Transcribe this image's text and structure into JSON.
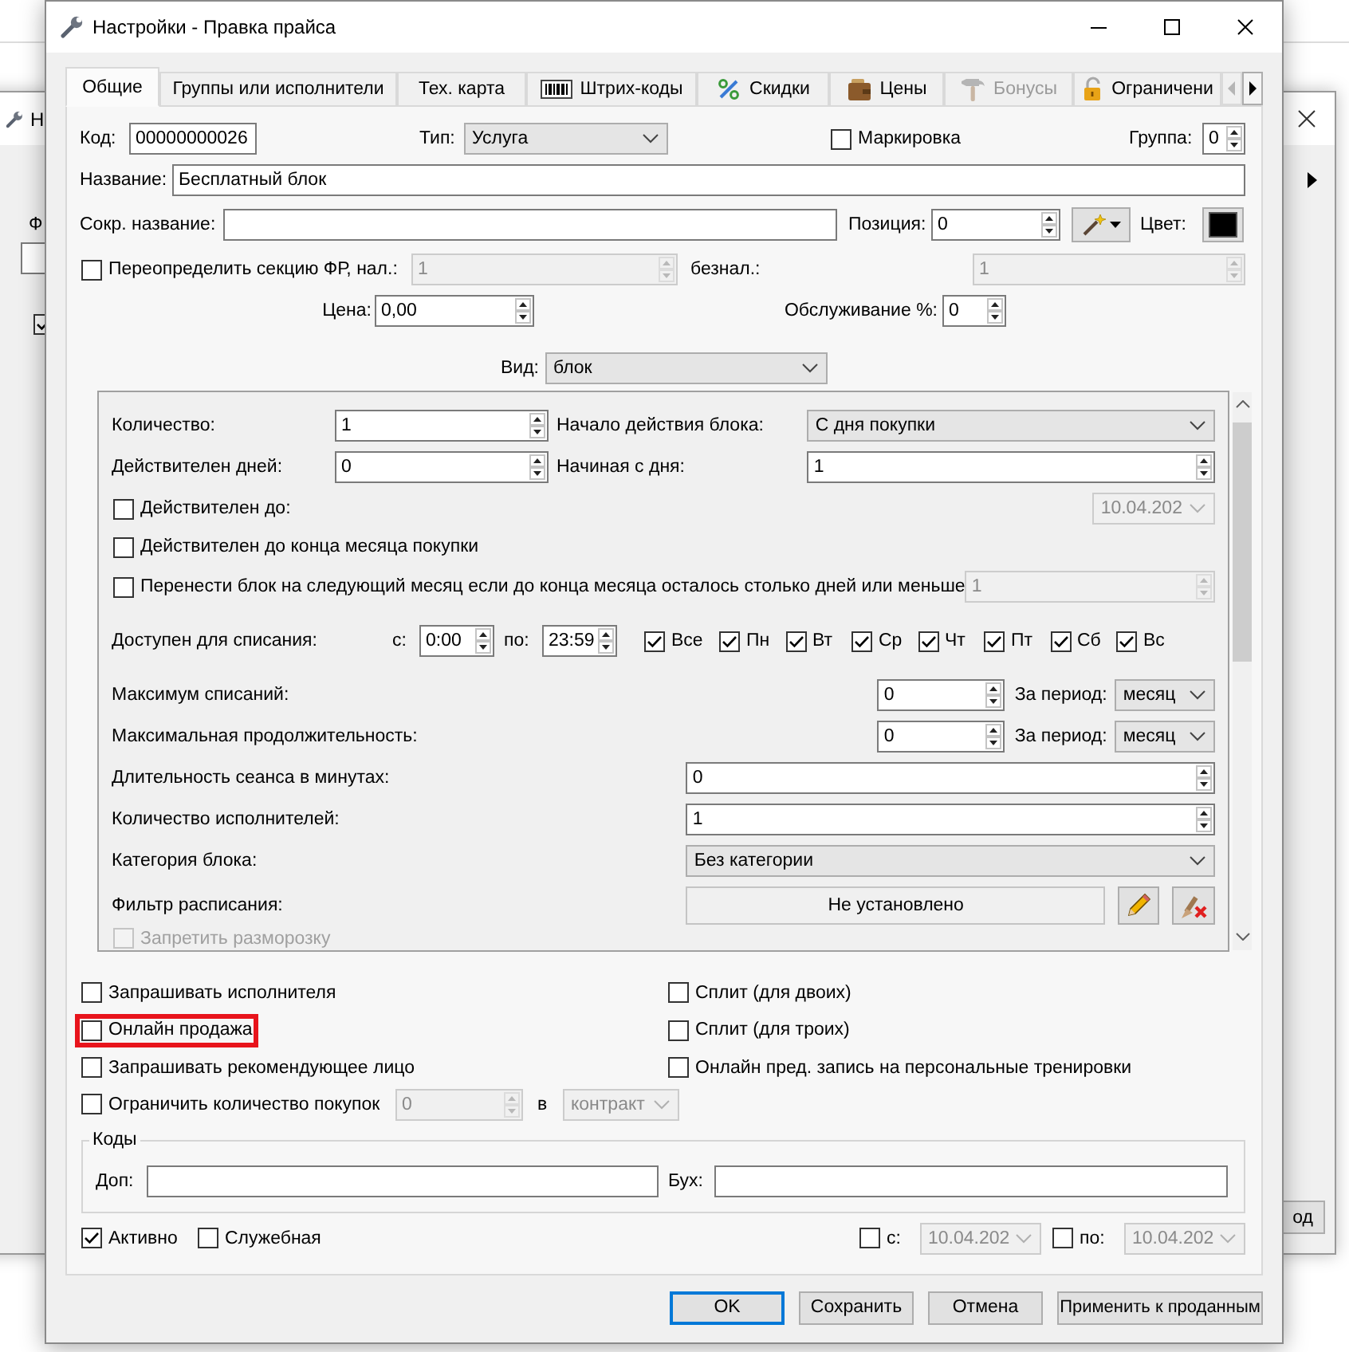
{
  "background_window": {
    "title": "Н",
    "field_label": "Ф",
    "checkbox": {
      "checked": true
    },
    "button": "од"
  },
  "window": {
    "title": "Настройки - Правка прайса"
  },
  "tabs": [
    {
      "label": "Общие",
      "selected": true,
      "disabled": false
    },
    {
      "label": "Группы или исполнители",
      "selected": false,
      "disabled": false
    },
    {
      "label": "Тех. карта",
      "selected": false,
      "disabled": false
    },
    {
      "label": "Штрих-коды",
      "selected": false,
      "disabled": false
    },
    {
      "label": "Скидки",
      "selected": false,
      "disabled": false
    },
    {
      "label": "Цены",
      "selected": false,
      "disabled": false
    },
    {
      "label": "Бонусы",
      "selected": false,
      "disabled": true
    },
    {
      "label": "Ограничени",
      "selected": false,
      "disabled": false
    }
  ],
  "general": {
    "code": {
      "label": "Код:",
      "value": "00000000026"
    },
    "type": {
      "label": "Тип:",
      "value": "Услуга"
    },
    "marking": {
      "label": "Маркировка",
      "checked": false
    },
    "group": {
      "label": "Группа:",
      "value": "0"
    },
    "name": {
      "label": "Название:",
      "value": "Бесплатный блок"
    },
    "short_name": {
      "label": "Сокр. название:"
    },
    "position": {
      "label": "Позиция:",
      "value": "0"
    },
    "color": {
      "label": "Цвет:",
      "color": "#000000"
    },
    "fr_section": {
      "label": "Переопределить секцию ФР, нал.:",
      "checked": false,
      "cash": "1",
      "cashless_label": "безнал.:",
      "cashless": "1"
    },
    "price": {
      "label": "Цена:",
      "value": "0,00"
    },
    "service": {
      "label": "Обслуживание %:",
      "value": "0"
    },
    "view": {
      "label": "Вид:",
      "value": "блок"
    }
  },
  "block": {
    "quantity": {
      "label": "Количество:",
      "value": "1"
    },
    "start": {
      "label": "Начало действия блока:",
      "value": "С дня покупки"
    },
    "valid_days": {
      "label": "Действителен дней:",
      "value": "0"
    },
    "from_day": {
      "label": "Начиная с дня:",
      "value": "1"
    },
    "valid_until": {
      "label": "Действителен до:",
      "checked": false,
      "value": "10.04.202"
    },
    "until_month_end": {
      "label": "Действителен до конца месяца покупки",
      "checked": false
    },
    "carry_over": {
      "label": "Перенести блок на следующий месяц если до конца месяца осталось столько дней или меньше",
      "checked": false,
      "value": "1"
    },
    "available": {
      "label": "Доступен для списания:",
      "from_label": "с:",
      "from": "0:00",
      "to_label": "по:",
      "to": "23:59",
      "days": [
        {
          "label": "Все",
          "checked": true
        },
        {
          "label": "Пн",
          "checked": true
        },
        {
          "label": "Вт",
          "checked": true
        },
        {
          "label": "Ср",
          "checked": true
        },
        {
          "label": "Чт",
          "checked": true
        },
        {
          "label": "Пт",
          "checked": true
        },
        {
          "label": "Сб",
          "checked": true
        },
        {
          "label": "Вс",
          "checked": true
        }
      ]
    },
    "max_uses": {
      "label": "Максимум списаний:",
      "value": "0",
      "period_label": "За период:",
      "period": "месяц"
    },
    "max_duration": {
      "label": "Максимальная продолжительность:",
      "value": "0",
      "period_label": "За период:",
      "period": "месяц"
    },
    "session_minutes": {
      "label": "Длительность сеанса в минутах:",
      "value": "0"
    },
    "performers": {
      "label": "Количество исполнителей:",
      "value": "1"
    },
    "category": {
      "label": "Категория блока:",
      "value": "Без категории"
    },
    "schedule_filter": {
      "label": "Фильтр расписания:",
      "value": "Не установлено"
    },
    "forbid_unfreeze": {
      "label": "Запретить разморозку",
      "checked": false,
      "disabled": true
    }
  },
  "options": [
    {
      "label": "Запрашивать исполнителя",
      "checked": false,
      "highlighted": false
    },
    {
      "label": "Сплит (для двоих)",
      "checked": false,
      "highlighted": false
    },
    {
      "label": "Онлайн продажа",
      "checked": false,
      "highlighted": true
    },
    {
      "label": "Сплит (для троих)",
      "checked": false,
      "highlighted": false
    },
    {
      "label": "Запрашивать рекомендующее лицо",
      "checked": false,
      "highlighted": false
    },
    {
      "label": "Онлайн пред. запись на персональные тренировки",
      "checked": false,
      "highlighted": false
    }
  ],
  "purchase_limit": {
    "label": "Ограничить количество покупок",
    "checked": false,
    "value": "0",
    "unit_label": "в",
    "unit": "контракт"
  },
  "codes": {
    "title": "Коды",
    "fields": [
      {
        "label": "Доп:"
      },
      {
        "label": "Бух:"
      }
    ]
  },
  "footer": {
    "active": {
      "label": "Активно",
      "checked": true
    },
    "service": {
      "label": "Служебная",
      "checked": false
    },
    "from": {
      "label": "с:",
      "checked": false,
      "value": "10.04.202"
    },
    "to": {
      "label": "по:",
      "checked": false,
      "value": "10.04.202"
    }
  },
  "buttons": [
    {
      "label": "OK",
      "default": true
    },
    {
      "label": "Сохранить",
      "default": false
    },
    {
      "label": "Отмена",
      "default": false
    },
    {
      "label": "Применить к проданным",
      "default": false
    }
  ]
}
